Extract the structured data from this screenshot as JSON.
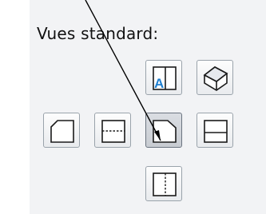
{
  "panel": {
    "title": "Vues standard:"
  },
  "buttons": [
    {
      "name": "view-top-button",
      "icon": "top-view-icon"
    },
    {
      "name": "view-isometric-button",
      "icon": "isometric-view-icon"
    },
    {
      "name": "view-left-button",
      "icon": "left-view-icon"
    },
    {
      "name": "view-back-button",
      "icon": "back-view-icon"
    },
    {
      "name": "view-front-button",
      "icon": "front-view-icon",
      "active": true
    },
    {
      "name": "view-right-button",
      "icon": "right-view-icon"
    },
    {
      "name": "view-bottom-button",
      "icon": "bottom-view-icon"
    }
  ],
  "colors": {
    "panel_bg": "#f2f3f5",
    "button_border": "#9aa3ab",
    "icon_stroke": "#1a1a1a",
    "accent_letter": "#1f7fd0"
  }
}
